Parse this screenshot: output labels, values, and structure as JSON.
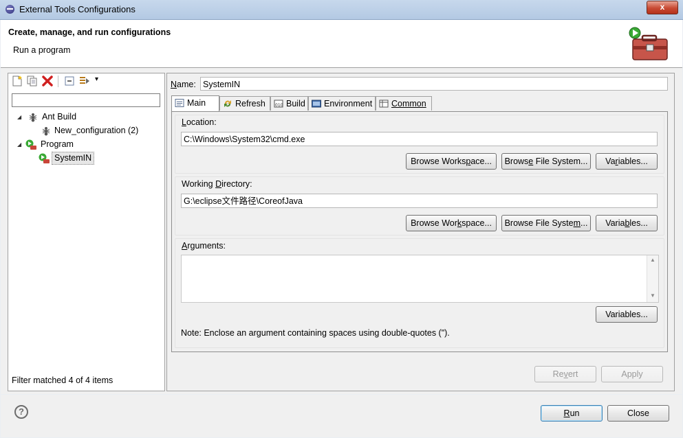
{
  "window": {
    "title": "External Tools Configurations",
    "close_label": "x"
  },
  "header": {
    "title": "Create, manage, and run configurations",
    "subtitle": "Run a program"
  },
  "toolbar": {
    "dropdown_glyph": "▾"
  },
  "filter": {
    "value": ""
  },
  "tree": [
    {
      "label": "Ant Build",
      "expanded": true
    },
    {
      "label": "New_configuration (2)"
    },
    {
      "label": "Program",
      "expanded": true
    },
    {
      "label": "SystemIN",
      "selected": true
    }
  ],
  "filter_status": "Filter matched 4 of 4 items",
  "config": {
    "name_label": "Name:",
    "name_value": "SystemIN",
    "tabs": [
      "Main",
      "Refresh",
      "Build",
      "Environment",
      "Common"
    ],
    "location_label": "Location:",
    "location_value": "C:\\Windows\\System32\\cmd.exe",
    "workdir_label": "Working Directory:",
    "workdir_value": "G:\\eclipse文件路径\\CoreofJava",
    "arguments_label": "Arguments:",
    "arguments_value": "",
    "note": "Note: Enclose an argument containing spaces using double-quotes (\").",
    "browse_workspace": "Browse Workspace...",
    "browse_filesystem": "Browse File System...",
    "variables": "Variables..."
  },
  "buttons": {
    "revert": "Revert",
    "apply": "Apply",
    "run": "Run",
    "close": "Close",
    "help": "?"
  },
  "colors": {
    "title_bar": "#b9cde6",
    "close_button": "#c84a33",
    "tree_selected": "#e6e6e6",
    "default_button_border": "#3c7fb1"
  },
  "icons": [
    "app-icon",
    "external-tools-icon",
    "new-config-icon",
    "duplicate-icon",
    "delete-icon",
    "collapse-all-icon",
    "filter-icon",
    "ant-icon",
    "program-icon",
    "help-icon"
  ]
}
